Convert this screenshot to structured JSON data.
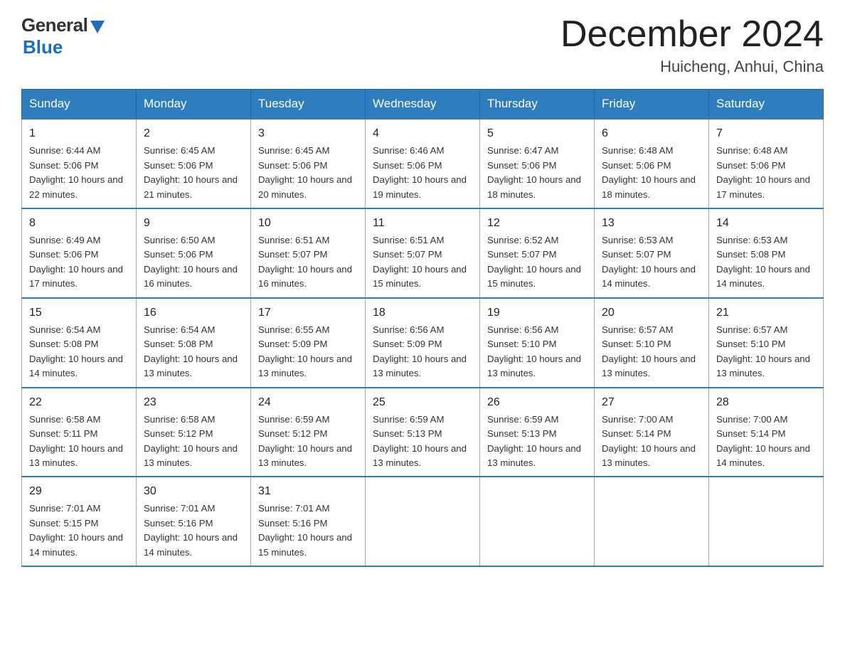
{
  "logo": {
    "general": "General",
    "blue": "Blue"
  },
  "header": {
    "month": "December 2024",
    "location": "Huicheng, Anhui, China"
  },
  "weekdays": [
    "Sunday",
    "Monday",
    "Tuesday",
    "Wednesday",
    "Thursday",
    "Friday",
    "Saturday"
  ],
  "weeks": [
    [
      {
        "day": "1",
        "sunrise": "6:44 AM",
        "sunset": "5:06 PM",
        "daylight": "10 hours and 22 minutes."
      },
      {
        "day": "2",
        "sunrise": "6:45 AM",
        "sunset": "5:06 PM",
        "daylight": "10 hours and 21 minutes."
      },
      {
        "day": "3",
        "sunrise": "6:45 AM",
        "sunset": "5:06 PM",
        "daylight": "10 hours and 20 minutes."
      },
      {
        "day": "4",
        "sunrise": "6:46 AM",
        "sunset": "5:06 PM",
        "daylight": "10 hours and 19 minutes."
      },
      {
        "day": "5",
        "sunrise": "6:47 AM",
        "sunset": "5:06 PM",
        "daylight": "10 hours and 18 minutes."
      },
      {
        "day": "6",
        "sunrise": "6:48 AM",
        "sunset": "5:06 PM",
        "daylight": "10 hours and 18 minutes."
      },
      {
        "day": "7",
        "sunrise": "6:48 AM",
        "sunset": "5:06 PM",
        "daylight": "10 hours and 17 minutes."
      }
    ],
    [
      {
        "day": "8",
        "sunrise": "6:49 AM",
        "sunset": "5:06 PM",
        "daylight": "10 hours and 17 minutes."
      },
      {
        "day": "9",
        "sunrise": "6:50 AM",
        "sunset": "5:06 PM",
        "daylight": "10 hours and 16 minutes."
      },
      {
        "day": "10",
        "sunrise": "6:51 AM",
        "sunset": "5:07 PM",
        "daylight": "10 hours and 16 minutes."
      },
      {
        "day": "11",
        "sunrise": "6:51 AM",
        "sunset": "5:07 PM",
        "daylight": "10 hours and 15 minutes."
      },
      {
        "day": "12",
        "sunrise": "6:52 AM",
        "sunset": "5:07 PM",
        "daylight": "10 hours and 15 minutes."
      },
      {
        "day": "13",
        "sunrise": "6:53 AM",
        "sunset": "5:07 PM",
        "daylight": "10 hours and 14 minutes."
      },
      {
        "day": "14",
        "sunrise": "6:53 AM",
        "sunset": "5:08 PM",
        "daylight": "10 hours and 14 minutes."
      }
    ],
    [
      {
        "day": "15",
        "sunrise": "6:54 AM",
        "sunset": "5:08 PM",
        "daylight": "10 hours and 14 minutes."
      },
      {
        "day": "16",
        "sunrise": "6:54 AM",
        "sunset": "5:08 PM",
        "daylight": "10 hours and 13 minutes."
      },
      {
        "day": "17",
        "sunrise": "6:55 AM",
        "sunset": "5:09 PM",
        "daylight": "10 hours and 13 minutes."
      },
      {
        "day": "18",
        "sunrise": "6:56 AM",
        "sunset": "5:09 PM",
        "daylight": "10 hours and 13 minutes."
      },
      {
        "day": "19",
        "sunrise": "6:56 AM",
        "sunset": "5:10 PM",
        "daylight": "10 hours and 13 minutes."
      },
      {
        "day": "20",
        "sunrise": "6:57 AM",
        "sunset": "5:10 PM",
        "daylight": "10 hours and 13 minutes."
      },
      {
        "day": "21",
        "sunrise": "6:57 AM",
        "sunset": "5:10 PM",
        "daylight": "10 hours and 13 minutes."
      }
    ],
    [
      {
        "day": "22",
        "sunrise": "6:58 AM",
        "sunset": "5:11 PM",
        "daylight": "10 hours and 13 minutes."
      },
      {
        "day": "23",
        "sunrise": "6:58 AM",
        "sunset": "5:12 PM",
        "daylight": "10 hours and 13 minutes."
      },
      {
        "day": "24",
        "sunrise": "6:59 AM",
        "sunset": "5:12 PM",
        "daylight": "10 hours and 13 minutes."
      },
      {
        "day": "25",
        "sunrise": "6:59 AM",
        "sunset": "5:13 PM",
        "daylight": "10 hours and 13 minutes."
      },
      {
        "day": "26",
        "sunrise": "6:59 AM",
        "sunset": "5:13 PM",
        "daylight": "10 hours and 13 minutes."
      },
      {
        "day": "27",
        "sunrise": "7:00 AM",
        "sunset": "5:14 PM",
        "daylight": "10 hours and 13 minutes."
      },
      {
        "day": "28",
        "sunrise": "7:00 AM",
        "sunset": "5:14 PM",
        "daylight": "10 hours and 14 minutes."
      }
    ],
    [
      {
        "day": "29",
        "sunrise": "7:01 AM",
        "sunset": "5:15 PM",
        "daylight": "10 hours and 14 minutes."
      },
      {
        "day": "30",
        "sunrise": "7:01 AM",
        "sunset": "5:16 PM",
        "daylight": "10 hours and 14 minutes."
      },
      {
        "day": "31",
        "sunrise": "7:01 AM",
        "sunset": "5:16 PM",
        "daylight": "10 hours and 15 minutes."
      },
      null,
      null,
      null,
      null
    ]
  ],
  "labels": {
    "sunrise_prefix": "Sunrise: ",
    "sunset_prefix": "Sunset: ",
    "daylight_prefix": "Daylight: "
  }
}
